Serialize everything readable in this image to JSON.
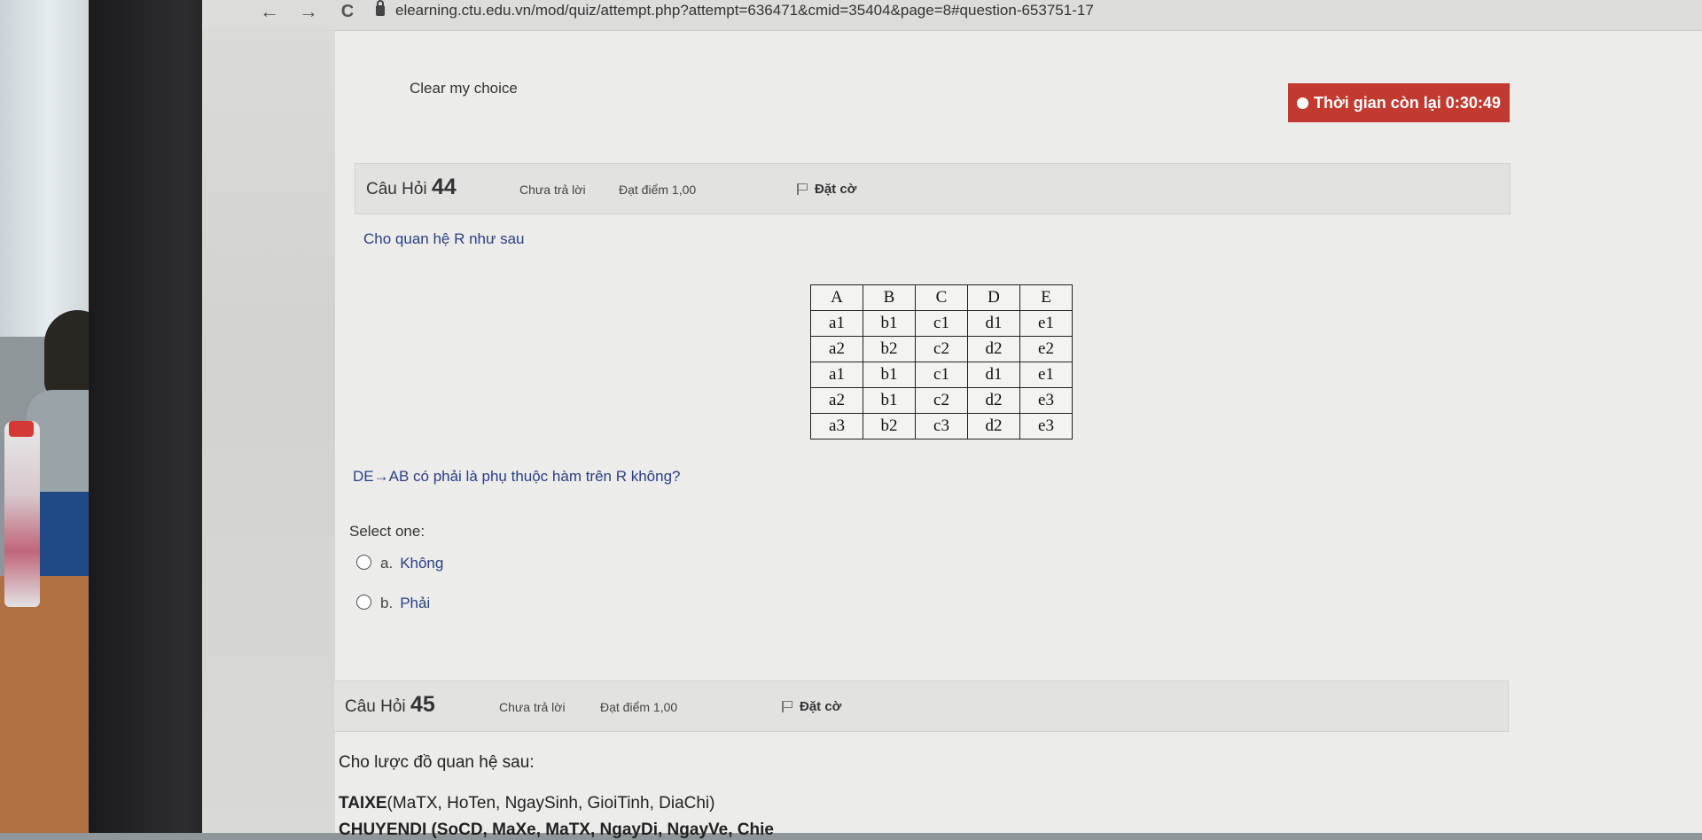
{
  "browser": {
    "url": "elearning.ctu.edu.vn/mod/quiz/attempt.php?attempt=636471&cmid=35404&page=8#question-653751-17",
    "back_icon": "←",
    "forward_icon": "→",
    "reload_icon": "C"
  },
  "quiz": {
    "clear_choice": "Clear my choice",
    "timer_label": "Thời gian còn lại 0:30:49",
    "timer_color": "#c23a2f"
  },
  "q44": {
    "title_prefix": "Câu Hỏi",
    "number": "44",
    "status": "Chưa trả lời",
    "points": "Đạt điểm 1,00",
    "flag": "Đặt cờ",
    "prompt": "Cho quan hệ R như sau",
    "table": {
      "headers": [
        "A",
        "B",
        "C",
        "D",
        "E"
      ],
      "rows": [
        [
          "a1",
          "b1",
          "c1",
          "d1",
          "e1"
        ],
        [
          "a2",
          "b2",
          "c2",
          "d2",
          "e2"
        ],
        [
          "a1",
          "b1",
          "c1",
          "d1",
          "e1"
        ],
        [
          "a2",
          "b1",
          "c2",
          "d2",
          "e3"
        ],
        [
          "a3",
          "b2",
          "c3",
          "d2",
          "e3"
        ]
      ]
    },
    "question": "DE→AB có phải là phụ thuộc hàm trên R không?",
    "select_one": "Select one:",
    "options": [
      {
        "letter": "a.",
        "text": "Không"
      },
      {
        "letter": "b.",
        "text": "Phải"
      }
    ]
  },
  "q45": {
    "title_prefix": "Câu Hỏi",
    "number": "45",
    "status": "Chưa trả lời",
    "points": "Đạt điểm 1,00",
    "flag": "Đặt cờ",
    "prompt": "Cho lược đồ quan hệ sau:",
    "schema_line1_name": "TAIXE",
    "schema_line1_attrs": "(MaTX, HoTen, NgaySinh, GioiTinh, DiaChi)",
    "schema_line2_partial": "CHUYENDI (SoCD, MaXe, MaTX, NgayDi, NgayVe, Chie"
  }
}
